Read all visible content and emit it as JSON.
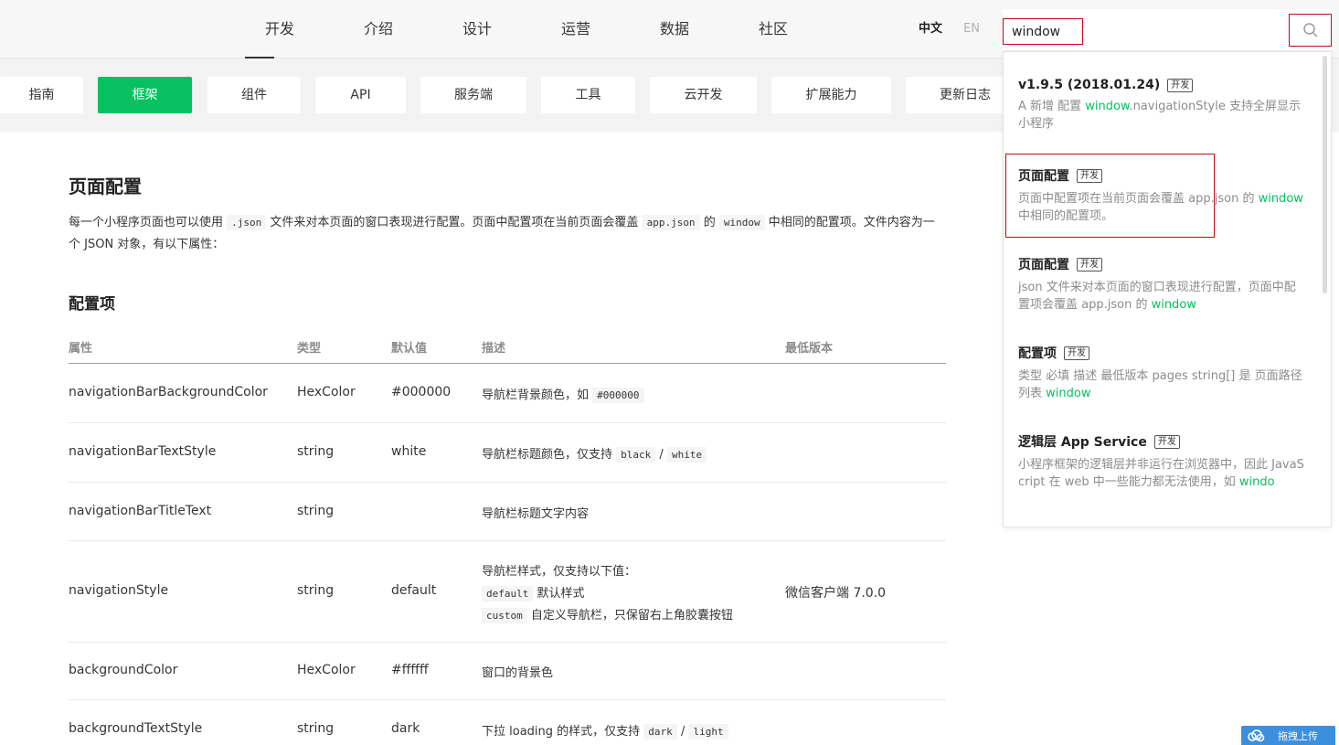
{
  "topnav": {
    "items": [
      "开发",
      "介绍",
      "设计",
      "运营",
      "数据",
      "社区"
    ],
    "lang_zh": "中文",
    "lang_en": "EN"
  },
  "search": {
    "value": "window"
  },
  "subnav": {
    "tabs": [
      "指南",
      "框架",
      "组件",
      "API",
      "服务端",
      "工具",
      "云开发",
      "扩展能力",
      "更新日志"
    ]
  },
  "content": {
    "title": "页面配置",
    "intro": {
      "p1": "每一个小程序页面也可以使用",
      "code1": ".json",
      "p2": "文件来对本页面的窗口表现进行配置。页面中配置项在当前页面会覆盖",
      "code2": "app.json",
      "p3": "的",
      "code3": "window",
      "p4": "中相同的配置项。文件内容为一个 JSON 对象，有以下属性："
    },
    "subtitle": "配置项",
    "table": {
      "headers": [
        "属性",
        "类型",
        "默认值",
        "描述",
        "最低版本"
      ],
      "rows": [
        {
          "prop": "navigationBarBackgroundColor",
          "type": "HexColor",
          "default": "#000000",
          "desc": "导航栏背景颜色，如",
          "code": "#000000"
        },
        {
          "prop": "navigationBarTextStyle",
          "type": "string",
          "default": "white",
          "desc": "导航栏标题颜色，仅支持",
          "code": "black",
          "sep": "/",
          "code2": "white"
        },
        {
          "prop": "navigationBarTitleText",
          "type": "string",
          "default": "",
          "desc": "导航栏标题文字内容"
        },
        {
          "prop": "navigationStyle",
          "type": "string",
          "default": "default",
          "desc": "导航栏样式，仅支持以下值：",
          "opt1_code": "default",
          "opt1_text": "默认样式",
          "opt2_code": "custom",
          "opt2_text": "自定义导航栏，只保留右上角胶囊按钮",
          "version": "微信客户端 7.0.0"
        },
        {
          "prop": "backgroundColor",
          "type": "HexColor",
          "default": "#ffffff",
          "desc": "窗口的背景色"
        },
        {
          "prop": "backgroundTextStyle",
          "type": "string",
          "default": "dark",
          "desc": "下拉 loading 的样式，仅支持",
          "code": "dark",
          "sep": "/",
          "code2": "light"
        }
      ]
    }
  },
  "dropdown": {
    "badge": "开发",
    "results": [
      {
        "title": "v1.9.5 (2018.01.24)",
        "desc_a": "A 新增 配置 ",
        "hl": "window",
        "desc_b": ".navigationStyle 支持全屏显示小程序"
      },
      {
        "title": "页面配置",
        "desc_a": "页面中配置项在当前页面会覆盖 app.json 的 ",
        "hl": "window",
        "desc_b": " 中相同的配置项。"
      },
      {
        "title": "页面配置",
        "desc_a": "json 文件来对本页面的窗口表现进行配置，页面中配置项会覆盖 app.json 的 ",
        "hl": "window",
        "desc_b": ""
      },
      {
        "title": "配置项",
        "desc_a": "类型 必填 描述 最低版本 pages string[] 是 页面路径列表 ",
        "hl": "window",
        "desc_b": ""
      },
      {
        "title": "逻辑层 App Service",
        "desc_a": "小程序框架的逻辑层并非运行在浏览器中，因此 JavaScript 在 web 中一些能力都无法使用，如 ",
        "hl": "windo",
        "desc_b": ""
      }
    ]
  },
  "upload": {
    "label": "拖拽上传"
  },
  "colors": {
    "accent": "#07c160",
    "highlight_border": "#d0021b"
  }
}
